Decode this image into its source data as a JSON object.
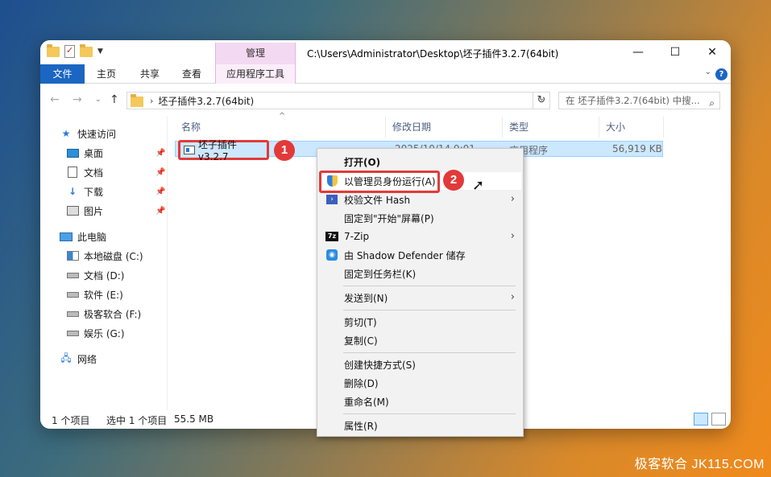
{
  "title_bar": {
    "context_tab_header": "管理",
    "path": "C:\\Users\\Administrator\\Desktop\\坯子插件3.2.7(64bit)",
    "controls": [
      "—",
      "☐",
      "✕"
    ]
  },
  "ribbon": {
    "tabs": [
      {
        "label": "文件"
      },
      {
        "label": "主页"
      },
      {
        "label": "共享"
      },
      {
        "label": "查看"
      },
      {
        "label": "应用程序工具"
      }
    ],
    "help": "?"
  },
  "address_bar": {
    "folder": "坯子插件3.2.7(64bit)",
    "search_placeholder": "在 坯子插件3.2.7(64bit) 中搜..."
  },
  "nav_pane": {
    "items": [
      {
        "label": "快速访问",
        "icon": "star-icon"
      },
      {
        "label": "桌面",
        "icon": "desktop-icon",
        "pinned": true
      },
      {
        "label": "文档",
        "icon": "document-icon",
        "pinned": true
      },
      {
        "label": "下载",
        "icon": "download-icon",
        "pinned": true
      },
      {
        "label": "图片",
        "icon": "pictures-icon",
        "pinned": true
      },
      {
        "label": "此电脑",
        "icon": "computer-icon"
      },
      {
        "label": "本地磁盘 (C:)",
        "icon": "system-drive-icon"
      },
      {
        "label": "文档 (D:)",
        "icon": "drive-icon"
      },
      {
        "label": "软件 (E:)",
        "icon": "drive-icon"
      },
      {
        "label": "极客软合 (F:)",
        "icon": "drive-icon"
      },
      {
        "label": "娱乐 (G:)",
        "icon": "drive-icon"
      },
      {
        "label": "网络",
        "icon": "network-icon"
      }
    ]
  },
  "file_list": {
    "columns": [
      "名称",
      "修改日期",
      "类型",
      "大小"
    ],
    "rows": [
      {
        "name": "坯子插件v3.2.7",
        "date": "2025/10/14 9:01",
        "type": "应用程序",
        "size": "56,919 KB"
      }
    ]
  },
  "status_bar": {
    "count": "1 个项目",
    "selected": "选中 1 个项目",
    "size": "55.5 MB"
  },
  "context_menu": {
    "items": [
      {
        "label": "打开(O)"
      },
      {
        "label": "以管理员身份运行(A)"
      },
      {
        "label": "校验文件 Hash"
      },
      {
        "label": "固定到\"开始\"屏幕(P)"
      },
      {
        "label": "7-Zip"
      },
      {
        "label": "由 Shadow Defender 储存"
      },
      {
        "label": "固定到任务栏(K)"
      },
      {
        "label": "发送到(N)"
      },
      {
        "label": "剪切(T)"
      },
      {
        "label": "复制(C)"
      },
      {
        "label": "创建快捷方式(S)"
      },
      {
        "label": "删除(D)"
      },
      {
        "label": "重命名(M)"
      },
      {
        "label": "属性(R)"
      }
    ]
  },
  "annotations": {
    "step1": "1",
    "step2": "2",
    "accent": "#e23a3a"
  },
  "watermark": "极客软合 JK115.COM"
}
